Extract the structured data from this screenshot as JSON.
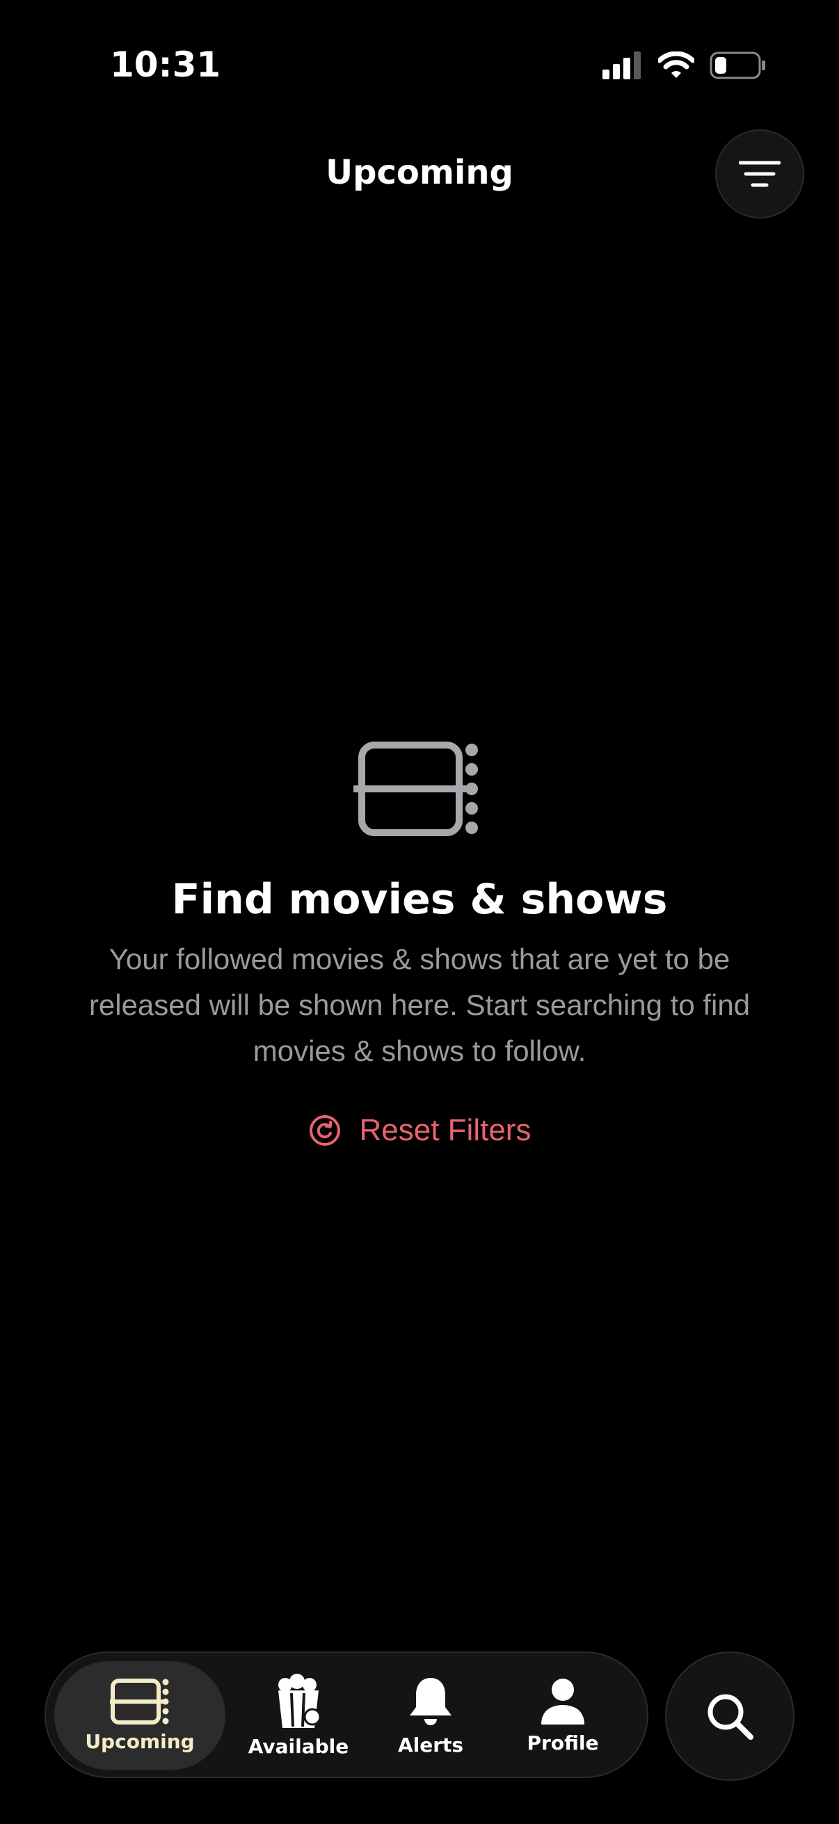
{
  "status_bar": {
    "time": "10:31",
    "icons": [
      "cellular-signal-icon",
      "wifi-icon",
      "battery-icon"
    ]
  },
  "header": {
    "title": "Upcoming",
    "filter_icon": "filter-lines-icon"
  },
  "empty_state": {
    "icon": "film-list-icon",
    "title": "Find movies & shows",
    "body": "Your followed movies & shows that are yet to be released will be shown here. Start searching to find movies & shows to follow.",
    "reset_label": "Reset Filters",
    "reset_icon": "reset-icon"
  },
  "tab_bar": {
    "tabs": [
      {
        "label": "Upcoming",
        "icon": "film-list-icon",
        "active": true
      },
      {
        "label": "Available",
        "icon": "popcorn-icon",
        "active": false
      },
      {
        "label": "Alerts",
        "icon": "bell-icon",
        "active": false
      },
      {
        "label": "Profile",
        "icon": "person-icon",
        "active": false
      }
    ],
    "search_icon": "search-icon"
  },
  "colors": {
    "background": "#000000",
    "accent": "#e8636e",
    "active_tab_label": "#f4ecc8",
    "muted_text": "#9a9a9e",
    "icon_gray": "#a8a8ac"
  }
}
